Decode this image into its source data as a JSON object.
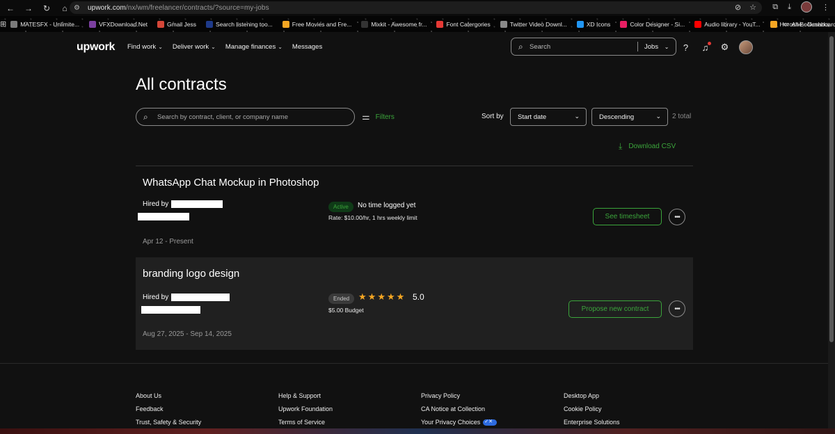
{
  "browser": {
    "url_host": "upwork.com",
    "url_path": "/nx/wm/freelancer/contracts/?source=my-jobs",
    "bookmarks": [
      {
        "label": "MATESFX - Unlimite...",
        "color": "#7a7a7a"
      },
      {
        "label": "VFXDownload.Net",
        "color": "#7b3fa0"
      },
      {
        "label": "Gmail Jess",
        "color": "#d44638"
      },
      {
        "label": "Search listening too...",
        "color": "#1e3a8a"
      },
      {
        "label": "Free Movies and Fre...",
        "color": "#f5a623"
      },
      {
        "label": "Mixkit - Awesome fr...",
        "color": "#333333"
      },
      {
        "label": "Font Catergories",
        "color": "#e53935"
      },
      {
        "label": "Twitter Video Downl...",
        "color": "#888888"
      },
      {
        "label": "XD Icons",
        "color": "#2196f3"
      },
      {
        "label": "Color Designer - Si...",
        "color": "#e91e63"
      },
      {
        "label": "Audio library - YouT...",
        "color": "#ff0000"
      },
      {
        "label": "Heroshe - Dashboard",
        "color": "#f5a623"
      }
    ],
    "all_bookmarks": "All Bookmarks"
  },
  "header": {
    "logo": "upwork",
    "nav": [
      {
        "label": "Find work",
        "chevron": true
      },
      {
        "label": "Deliver work",
        "chevron": true
      },
      {
        "label": "Manage finances",
        "chevron": true
      },
      {
        "label": "Messages",
        "chevron": false
      }
    ],
    "search_placeholder": "Search",
    "search_scope": "Jobs"
  },
  "page": {
    "title": "All contracts",
    "search_placeholder": "Search by contract, client, or company name",
    "filters_label": "Filters",
    "sort_by_label": "Sort by",
    "sort_field": "Start date",
    "sort_order": "Descending",
    "total": "2 total",
    "download_label": "Download CSV"
  },
  "contracts": [
    {
      "title": "WhatsApp Chat Mockup in Photoshop",
      "hired_by": "Hired by",
      "status": "Active",
      "status_text": "No time logged yet",
      "rate": "Rate: $10.00/hr, 1 hrs weekly limit",
      "dates": "Apr 12 - Present",
      "action": "See timesheet"
    },
    {
      "title": "branding logo design",
      "hired_by": "Hired by",
      "status": "Ended",
      "rating": "5.0",
      "stars": 5,
      "budget": "$5.00 Budget",
      "dates": "Aug 27, 2025 - Sep 14, 2025",
      "action": "Propose new contract"
    }
  ],
  "footer": {
    "col1": [
      "About Us",
      "Feedback",
      "Trust, Safety & Security"
    ],
    "col2": [
      "Help & Support",
      "Upwork Foundation",
      "Terms of Service"
    ],
    "col3": [
      "Privacy Policy",
      "CA Notice at Collection",
      "Your Privacy Choices"
    ],
    "col4": [
      "Desktop App",
      "Cookie Policy",
      "Enterprise Solutions"
    ]
  },
  "colors": {
    "accent_green": "#3ba53b",
    "star": "#f5a623"
  }
}
